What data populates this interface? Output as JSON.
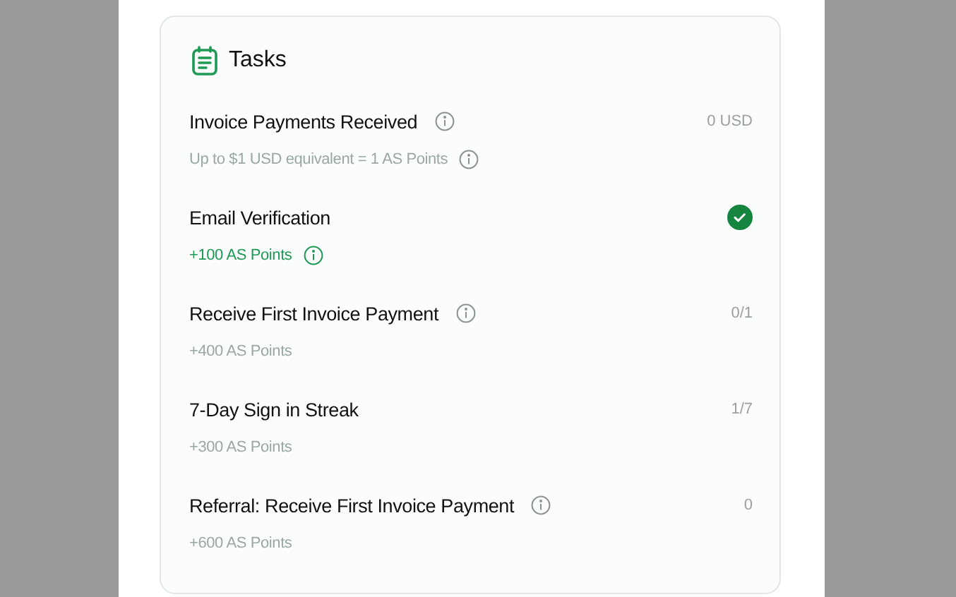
{
  "card": {
    "title": "Tasks"
  },
  "tasks": [
    {
      "title": "Invoice Payments Received",
      "title_info": true,
      "progress": "0 USD",
      "completed": false,
      "reward": "Up to $1 USD equivalent = 1 AS Points",
      "reward_info": true
    },
    {
      "title": "Email Verification",
      "title_info": false,
      "completed": true,
      "reward": "+100 AS Points",
      "reward_info": true
    },
    {
      "title": "Receive First Invoice Payment",
      "title_info": true,
      "progress": "0/1",
      "completed": false,
      "reward": "+400 AS Points",
      "reward_info": false
    },
    {
      "title": "7-Day Sign in Streak",
      "title_info": false,
      "progress": "1/7",
      "completed": false,
      "reward": "+300 AS Points",
      "reward_info": false
    },
    {
      "title": "Referral: Receive First Invoice Payment",
      "title_info": true,
      "progress": "0",
      "completed": false,
      "reward": "+600 AS Points",
      "reward_info": false
    }
  ]
}
